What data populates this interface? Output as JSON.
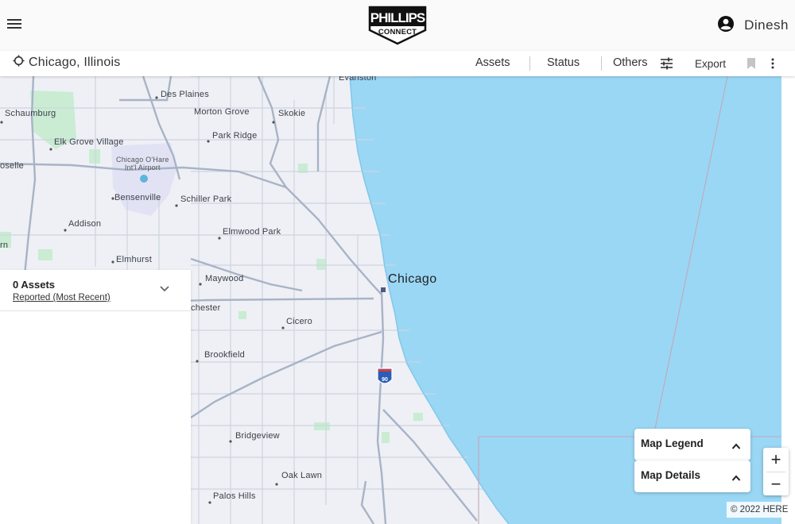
{
  "header": {
    "logo_line1": "PHILLIPS",
    "logo_line2": "CONNECT",
    "user_name": "Dinesh",
    "menu_icon": "hamburger-menu-icon",
    "user_icon": "account-circle-icon"
  },
  "toolbar": {
    "location": "Chicago, Illinois",
    "location_icon": "crosshair-icon",
    "assets_label": "Assets",
    "status_label": "Status",
    "others_label": "Others",
    "filter_icon": "sliders-icon",
    "export_label": "Export",
    "bookmark_icon": "bookmark-icon",
    "more_icon": "more-vert-icon"
  },
  "map": {
    "places": {
      "evanston": "Evanston",
      "des_plaines": "Des Plaines",
      "schaumburg": "Schaumburg",
      "morton_grove": "Morton Grove",
      "skokie": "Skokie",
      "elk_grove_village": "Elk Grove Village",
      "park_ridge": "Park Ridge",
      "roselle": "oselle",
      "ohare_line1": "Chicago O'Hare",
      "ohare_line2": "Int'l Airport",
      "bensenville": "Bensenville",
      "schiller_park": "Schiller Park",
      "addison": "Addison",
      "elmwood_park": "Elmwood Park",
      "lombard": "rn",
      "elmhurst": "Elmhurst",
      "chicago": "Chicago",
      "maywood": "Maywood",
      "westchester": "chester",
      "cicero": "Cicero",
      "brookfield": "Brookfield",
      "bridgeview": "Bridgeview",
      "oak_lawn": "Oak Lawn",
      "palos_hills": "Palos Hills",
      "interstate_shield": "90"
    },
    "colors": {
      "water": "#9ad7f5",
      "land": "#eef0f5",
      "major_road": "#a8b3c6",
      "minor_road": "#cdd4e0",
      "park": "#c9ecd3"
    }
  },
  "assets_panel": {
    "count_label": "0 Assets",
    "sort_label": "Reported (Most Recent)",
    "chevron_icon": "chevron-down-icon"
  },
  "map_cards": {
    "legend_label": "Map Legend",
    "details_label": "Map Details",
    "chevron_icon": "chevron-up-icon"
  },
  "zoom": {
    "in_label": "+",
    "out_label": "−"
  },
  "attribution": "© 2022 HERE"
}
